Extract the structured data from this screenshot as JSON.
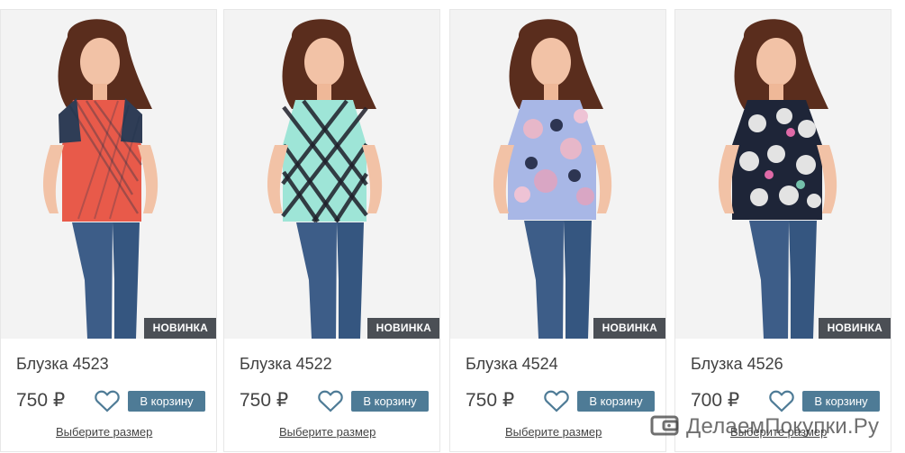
{
  "products": [
    {
      "name": "Блузка 4523",
      "price": "750 ₽",
      "badge": "НОВИНКА",
      "cart_label": "В корзину",
      "size_link": "Выберите размер",
      "top_color": "#e85a4a",
      "top_accent": "#2a66b7"
    },
    {
      "name": "Блузка 4522",
      "price": "750 ₽",
      "badge": "НОВИНКА",
      "cart_label": "В корзину",
      "size_link": "Выберите размер",
      "top_color": "#9ee5d7",
      "top_accent": "#1f1f2a"
    },
    {
      "name": "Блузка 4524",
      "price": "750 ₽",
      "badge": "НОВИНКА",
      "cart_label": "В корзину",
      "size_link": "Выберите размер",
      "top_color": "#a8b7e6",
      "top_accent": "#e7b7c9"
    },
    {
      "name": "Блузка 4526",
      "price": "700 ₽",
      "badge": "НОВИНКА",
      "cart_label": "В корзину",
      "size_link": "Выберите размер",
      "top_color": "#1e2538",
      "top_accent": "#e3e3e3"
    }
  ],
  "icons": {
    "favorite": "heart-outline-icon"
  },
  "colors": {
    "badge": "#4b4f55",
    "cart_button": "#4e7b96",
    "heart": "#4e7b96"
  },
  "watermark": {
    "text": "ДелаемПокупки.Ру",
    "icon": "wallet-icon"
  }
}
